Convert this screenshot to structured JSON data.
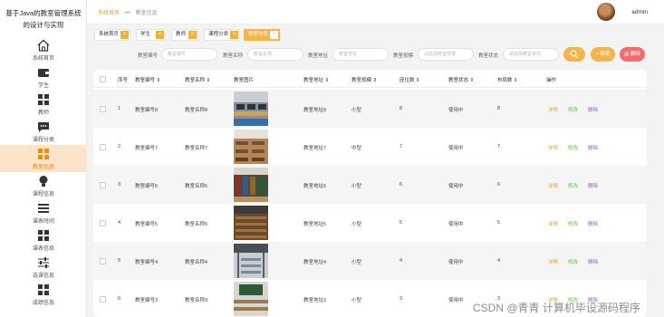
{
  "app": {
    "title_line1": "基于Java的教室管理系统",
    "title_line2": "的设计与实现"
  },
  "sidebar": {
    "items": [
      {
        "label": "系统首页",
        "icon": "home-icon",
        "active": false
      },
      {
        "label": "学生",
        "icon": "wallet-icon",
        "active": false
      },
      {
        "label": "教师",
        "icon": "grid-icon",
        "active": false
      },
      {
        "label": "课程分类",
        "icon": "chat-icon",
        "active": false
      },
      {
        "label": "教室信息",
        "icon": "grid-icon",
        "active": true
      },
      {
        "label": "课程信息",
        "icon": "bulb-icon",
        "active": false
      },
      {
        "label": "课表时间",
        "icon": "list-icon",
        "active": false
      },
      {
        "label": "课表信息",
        "icon": "grid-icon",
        "active": false
      },
      {
        "label": "选课信息",
        "icon": "sliders-icon",
        "active": false
      },
      {
        "label": "成绩信息",
        "icon": "grid-icon",
        "active": false
      }
    ]
  },
  "header": {
    "breadcrumb_home": "系统首页",
    "breadcrumb_sep": "•••",
    "breadcrumb_current": "教室信息",
    "username": "admin"
  },
  "tags": [
    {
      "label": "系统首页",
      "active": false
    },
    {
      "label": "学生",
      "active": false
    },
    {
      "label": "教师",
      "active": false
    },
    {
      "label": "课程分类",
      "active": false
    },
    {
      "label": "教室信息",
      "active": true
    }
  ],
  "search": {
    "fields": [
      {
        "label": "教室编号",
        "placeholder": "教室编号"
      },
      {
        "label": "教室名称",
        "placeholder": "教室名称"
      },
      {
        "label": "教室地址",
        "placeholder": "教室地址"
      },
      {
        "label": "教室规模",
        "placeholder": "请选择教室规模"
      },
      {
        "label": "教室状态",
        "placeholder": "请选择教室状态"
      }
    ],
    "search_button": "",
    "add_button": "新增",
    "delete_button": "删除"
  },
  "table": {
    "headers": [
      "",
      "序号",
      "教室编号",
      "教室名称",
      "教室图片",
      "教室地址",
      "教室规模",
      "座位数",
      "教室状态",
      "布局数",
      "操作"
    ],
    "sort_arrow": "⇕",
    "rows": [
      {
        "index": "1",
        "code": "教室编号8",
        "name": "教室名称8",
        "address": "教室地址8",
        "size": "小型",
        "seats": "8",
        "status": "使用中",
        "layout": "8",
        "photo": "photo-computer-lab"
      },
      {
        "index": "2",
        "code": "教室编号7",
        "name": "教室名称7",
        "address": "教室地址7",
        "size": "中型",
        "seats": "7",
        "status": "使用中",
        "layout": "7",
        "photo": "photo-wood-desks"
      },
      {
        "index": "3",
        "code": "教室编号6",
        "name": "教室名称6",
        "address": "教室地址6",
        "size": "小型",
        "seats": "6",
        "status": "使用中",
        "layout": "6",
        "photo": "photo-library"
      },
      {
        "index": "4",
        "code": "教室编号5",
        "name": "教室名称5",
        "address": "教室地址5",
        "size": "小型",
        "seats": "5",
        "status": "使用中",
        "layout": "5",
        "photo": "photo-lecture-hall"
      },
      {
        "index": "5",
        "code": "教室编号4",
        "name": "教室名称4",
        "address": "教室地址4",
        "size": "小型",
        "seats": "4",
        "status": "使用中",
        "layout": "4",
        "photo": "photo-study-hall"
      },
      {
        "index": "6",
        "code": "教室编号3",
        "name": "教室名称3",
        "address": "教室地址3",
        "size": "小型",
        "seats": "3",
        "status": "使用中",
        "layout": "3",
        "photo": "photo-blackboard-room"
      }
    ],
    "actions": {
      "view": "详情",
      "edit": "修改",
      "delete": "删除"
    }
  },
  "watermark": "CSDN @青青  计算机毕设源码程序",
  "colors": {
    "accent": "#f5b349",
    "active_bg": "#fbe4c9",
    "danger": "#f56c6c",
    "view": "#e6a23c",
    "edit": "#67c23a",
    "del": "#9b59d0"
  }
}
